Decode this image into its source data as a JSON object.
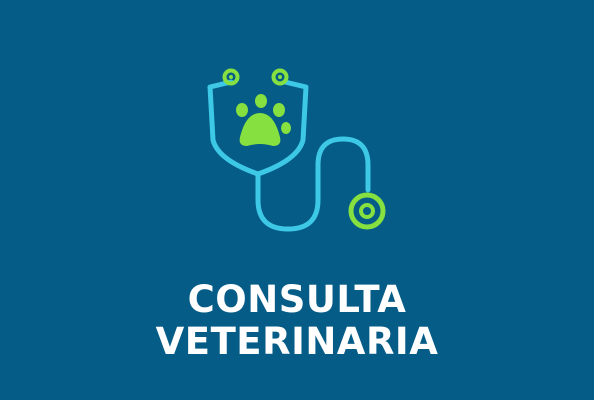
{
  "card": {
    "icon": "stethoscope-paw-icon",
    "title_line1": "CONSULTA",
    "title_line2": "VETERINARIA"
  },
  "colors": {
    "background": "#045c87",
    "stethoscope": "#3dc8e6",
    "accent": "#86e040",
    "text": "#ffffff"
  }
}
